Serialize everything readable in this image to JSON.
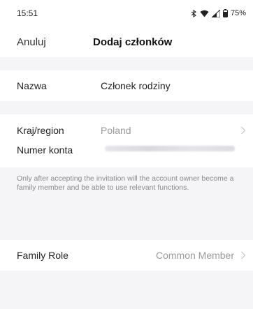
{
  "status_bar": {
    "time": "15:51",
    "battery": "75%",
    "icons": [
      "bluetooth-icon",
      "wifi-icon",
      "signal-icon",
      "battery-icon"
    ]
  },
  "nav": {
    "cancel_label": "Anuluj",
    "title": "Dodaj członków"
  },
  "form": {
    "name_label": "Nazwa",
    "name_value": "Członek rodziny",
    "country_label": "Kraj/region",
    "country_value": "Poland",
    "account_label": "Numer konta",
    "notice": "Only after accepting the invitation will the account owner become a family member and be able to use relevant functions.",
    "role_label": "Family Role",
    "role_value": "Common Member"
  },
  "colors": {
    "background": "#f5f5f7",
    "surface": "#ffffff",
    "muted_text": "#999999"
  }
}
